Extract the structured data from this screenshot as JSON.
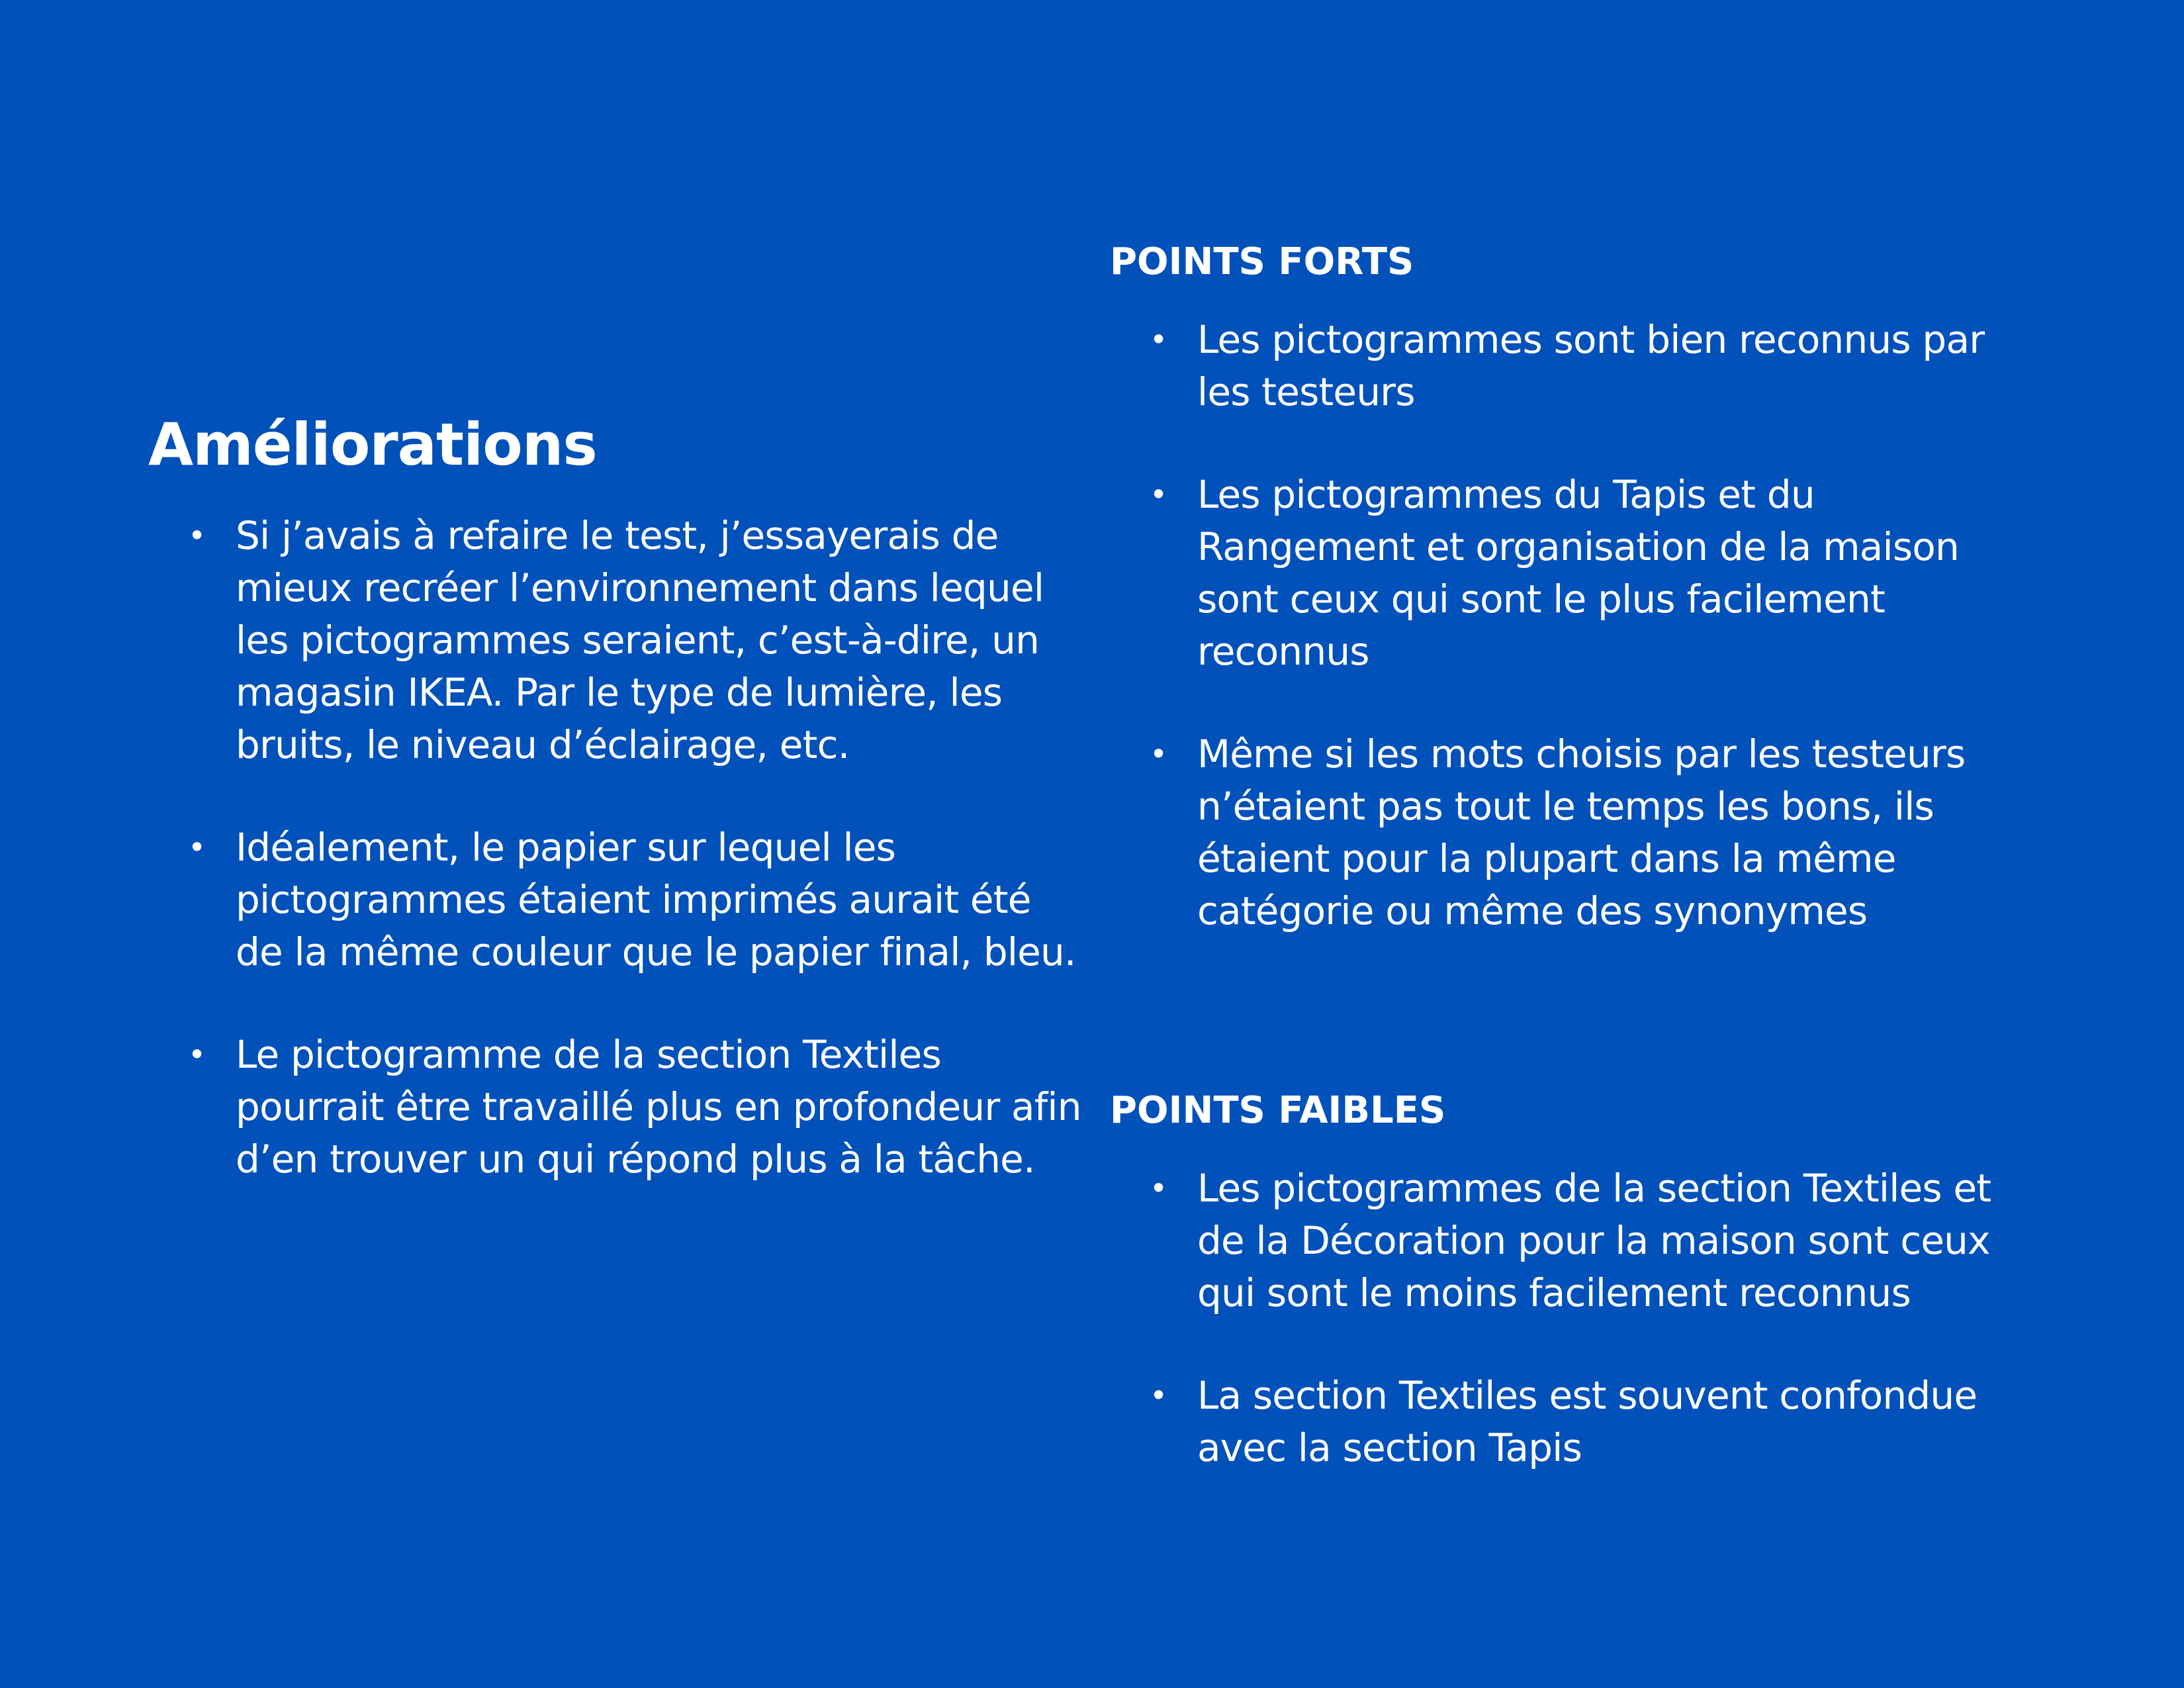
{
  "colors": {
    "background": "#0051BA",
    "text": "#FFFFFF"
  },
  "ameliorations": {
    "title": "Améliorations",
    "items": [
      "Si j’avais à refaire le test, j’essayerais de mieux recréer l’environnement dans lequel les pictogrammes seraient, c’est-à-dire, un magasin IKEA. Par le type de lumière, les bruits, le niveau d’éclairage, etc.",
      "Idéalement, le papier sur lequel les pictogrammes étaient imprimés aurait été de la même couleur que le papier final, bleu.",
      "Le pictogramme de la section Textiles pourrait être travaillé plus en profondeur afin d’en trouver un qui répond plus à la tâche."
    ]
  },
  "points_forts": {
    "heading": "POINTS FORTS",
    "items": [
      "Les pictogrammes sont bien reconnus par les testeurs",
      "Les pictogrammes du Tapis et du Rangement et organisation de la maison sont ceux qui sont le plus facilement reconnus",
      "Même si les mots choisis par les testeurs n’étaient pas tout le temps les bons, ils étaient pour la plupart dans la même catégorie ou même des synonymes"
    ]
  },
  "points_faibles": {
    "heading": "POINTS FAIBLES",
    "items": [
      "Les pictogrammes de la section Textiles et de la Décoration pour la maison sont ceux qui sont le moins facilement reconnus",
      "La section Textiles est souvent confondue avec la section Tapis"
    ]
  },
  "bullet_symbol": "•"
}
